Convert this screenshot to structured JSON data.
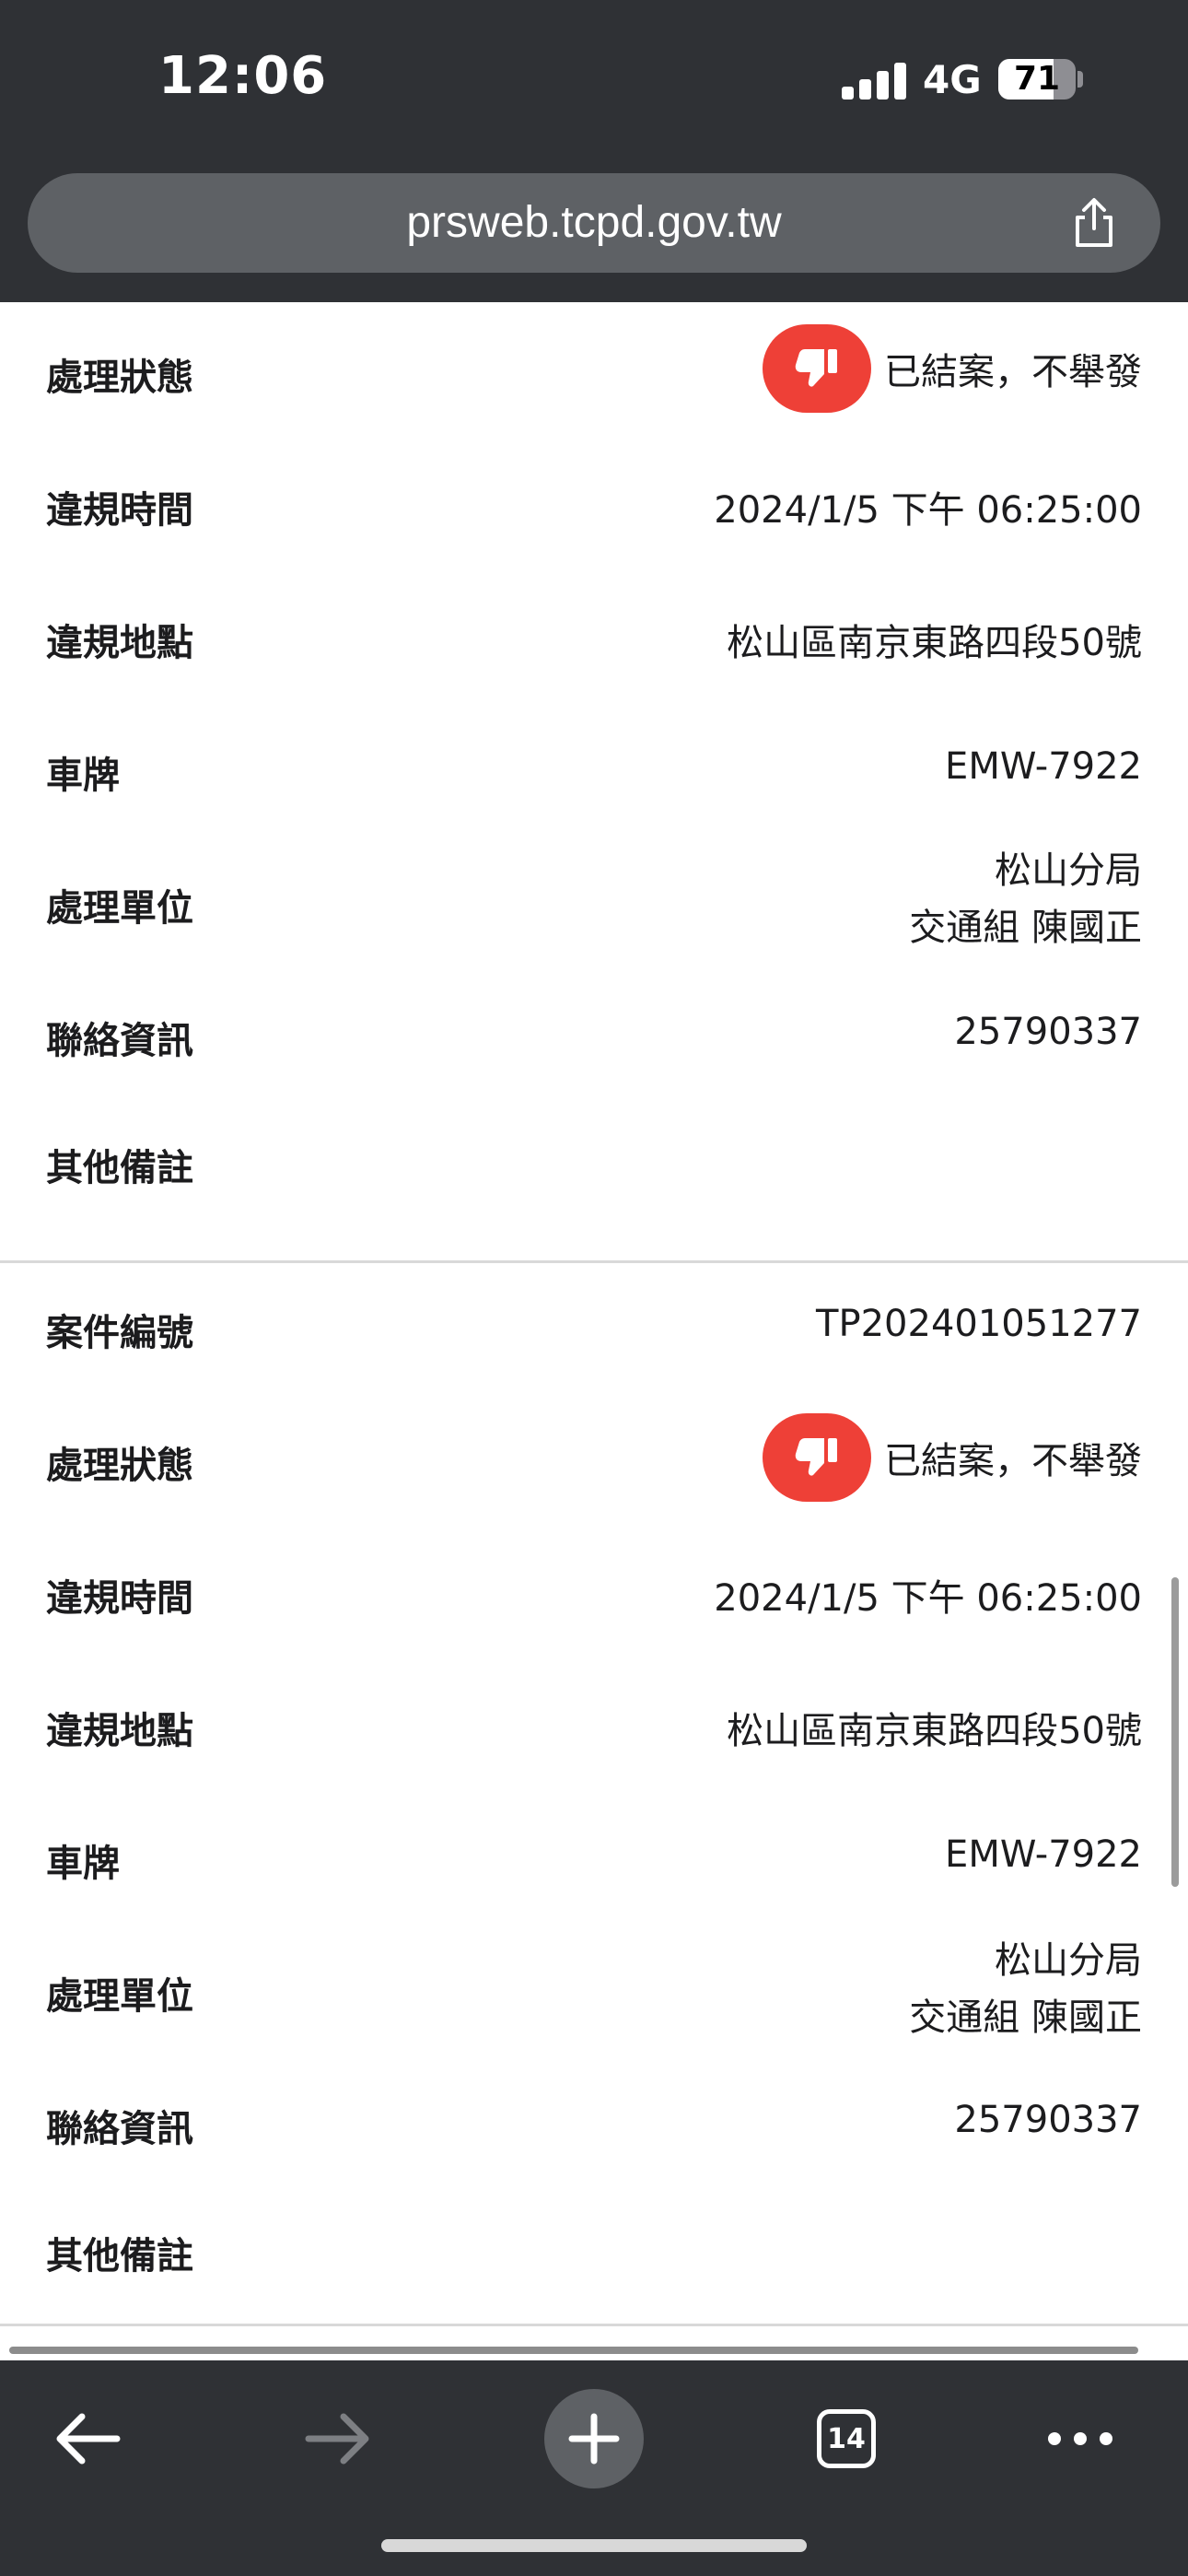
{
  "status_bar": {
    "time": "12:06",
    "network": "4G",
    "battery": "71",
    "battery_level": 0.71
  },
  "browser": {
    "url": "prsweb.tcpd.gov.tw",
    "tab_count": "14"
  },
  "labels": {
    "case_number": "案件編號",
    "status": "處理狀態",
    "violation_time": "違規時間",
    "violation_location": "違規地點",
    "plate": "車牌",
    "unit": "處理單位",
    "contact": "聯絡資訊",
    "remarks": "其他備註"
  },
  "records": [
    {
      "status": "已結案，不舉發",
      "status_icon": "thumbs-down-icon",
      "violation_time": "2024/1/5 下午 06:25:00",
      "violation_location": "松山區南京東路四段50號",
      "plate": "EMW-7922",
      "unit_line1": "松山分局",
      "unit_line2": "交通組 陳國正",
      "contact": "25790337",
      "remarks": ""
    },
    {
      "case_number": "TP202401051277",
      "status": "已結案，不舉發",
      "status_icon": "thumbs-down-icon",
      "violation_time": "2024/1/5 下午 06:25:00",
      "violation_location": "松山區南京東路四段50號",
      "plate": "EMW-7922",
      "unit_line1": "松山分局",
      "unit_line2": "交通組 陳國正",
      "contact": "25790337",
      "remarks": ""
    }
  ],
  "colors": {
    "bar_bg": "#2f3135",
    "url_bg": "#5e6165",
    "status_red": "#ee4037"
  }
}
